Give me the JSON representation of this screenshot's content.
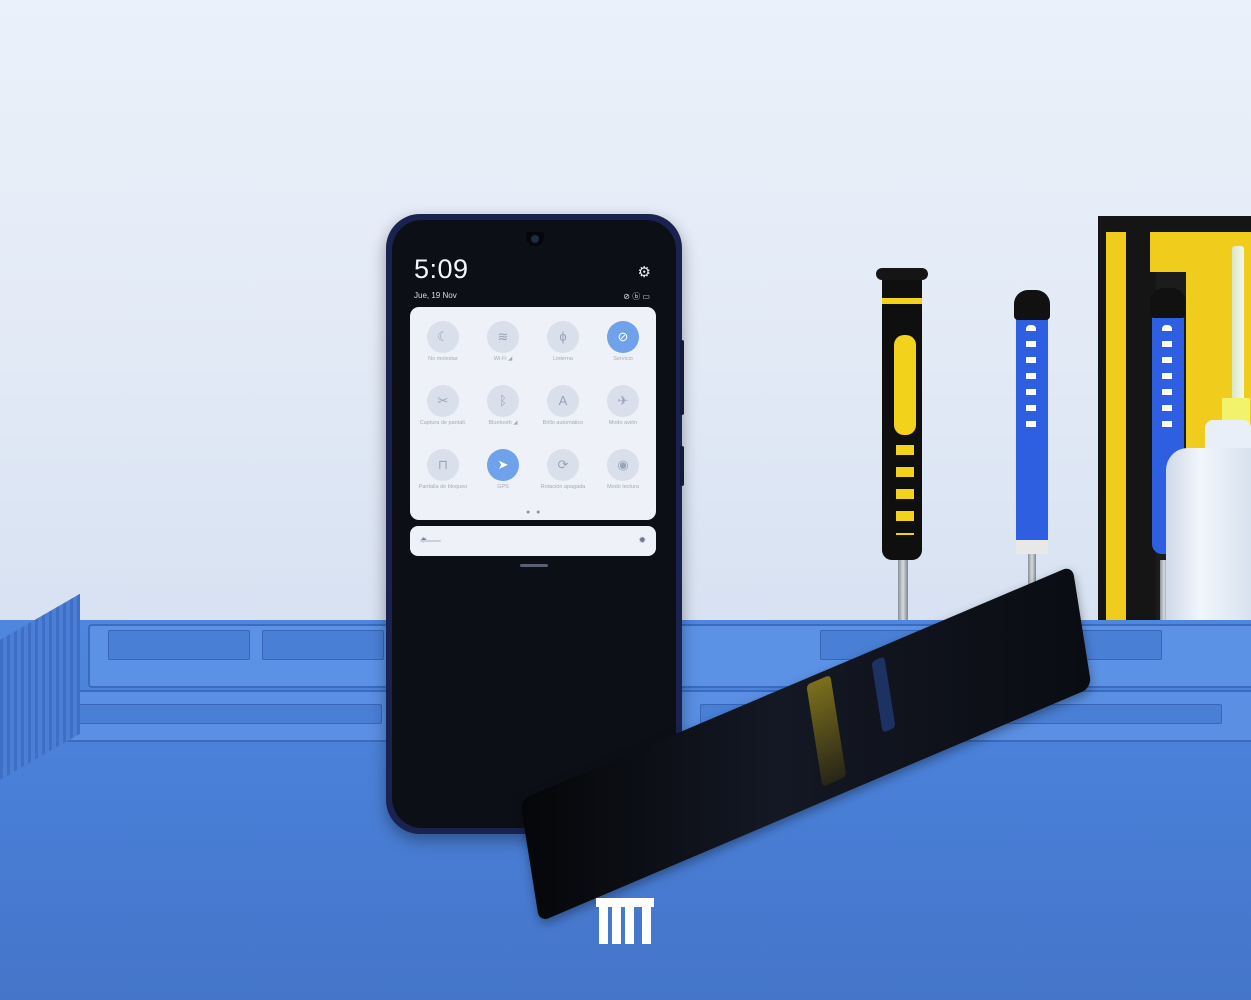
{
  "photo": {
    "description_free": true
  },
  "phone": {
    "clock": "5:09",
    "date": "Jue, 19 Nov",
    "status_icons": "⊘ ⓑ ▭",
    "settings_icon": "gear-icon",
    "quick_settings": [
      {
        "label": "No molestar",
        "icon": "moon-icon",
        "active": false
      },
      {
        "label": "Wi-Fi ◢",
        "icon": "wifi-icon",
        "active": false
      },
      {
        "label": "Linterna",
        "icon": "flashlight-icon",
        "active": false
      },
      {
        "label": "Servicio",
        "icon": "mobile-data-icon",
        "active": true
      },
      {
        "label": "Captura de pantall.",
        "icon": "screenshot-icon",
        "active": false
      },
      {
        "label": "Bluetooth ◢",
        "icon": "bluetooth-icon",
        "active": false
      },
      {
        "label": "Brillo automático",
        "icon": "auto-brightness-icon",
        "active": false
      },
      {
        "label": "Modo avión",
        "icon": "airplane-icon",
        "active": false
      },
      {
        "label": "Pantalla de bloqueo",
        "icon": "lock-icon",
        "active": false
      },
      {
        "label": "GPS",
        "icon": "location-icon",
        "active": true
      },
      {
        "label": "Rotación apagada",
        "icon": "rotation-icon",
        "active": false
      },
      {
        "label": "Modo lectura",
        "icon": "eye-icon",
        "active": false
      }
    ],
    "page_dots": "● ●",
    "brightness_level": 0.1
  },
  "colors": {
    "mat": "#4a80d8",
    "wall": "#e6edf8",
    "qs_active": "#6fa2ea",
    "screwdriver_accent": "#f2d21a"
  }
}
